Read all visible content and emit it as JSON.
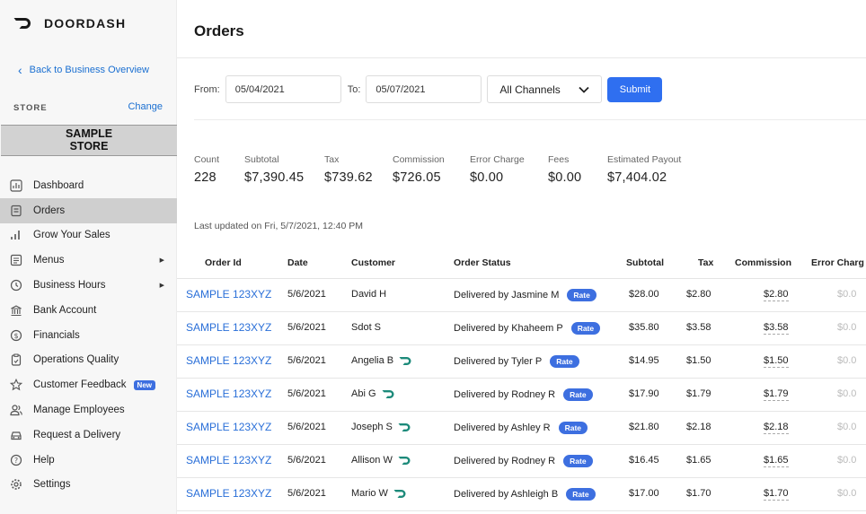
{
  "brand": {
    "name": "DOORDASH"
  },
  "sidebar": {
    "back_label": "Back to Business Overview",
    "store_label": "STORE",
    "change_label": "Change",
    "store_name_line1": "SAMPLE",
    "store_name_line2": "STORE",
    "items": [
      {
        "label": "Dashboard",
        "icon": "chart-icon"
      },
      {
        "label": "Orders",
        "icon": "orders-icon",
        "active": true
      },
      {
        "label": "Grow Your Sales",
        "icon": "bars-icon"
      },
      {
        "label": "Menus",
        "icon": "menu-icon",
        "has_submenu": true
      },
      {
        "label": "Business Hours",
        "icon": "clock-icon",
        "has_submenu": true
      },
      {
        "label": "Bank Account",
        "icon": "bank-icon"
      },
      {
        "label": "Financials",
        "icon": "dollar-icon"
      },
      {
        "label": "Operations Quality",
        "icon": "clipboard-icon"
      },
      {
        "label": "Customer Feedback",
        "icon": "star-icon",
        "badge": "New"
      },
      {
        "label": "Manage Employees",
        "icon": "people-icon"
      },
      {
        "label": "Request a Delivery",
        "icon": "car-icon"
      },
      {
        "label": "Help",
        "icon": "help-icon"
      },
      {
        "label": "Settings",
        "icon": "gear-icon"
      }
    ]
  },
  "main": {
    "title": "Orders",
    "filters": {
      "from_label": "From:",
      "from_value": "05/04/2021",
      "to_label": "To:",
      "to_value": "05/07/2021",
      "channel": "All Channels",
      "submit_label": "Submit"
    },
    "stats": [
      {
        "label": "Count",
        "value": "228"
      },
      {
        "label": "Subtotal",
        "value": "$7,390.45"
      },
      {
        "label": "Tax",
        "value": "$739.62"
      },
      {
        "label": "Commission",
        "value": "$726.05"
      },
      {
        "label": "Error Charge",
        "value": "$0.00"
      },
      {
        "label": "Fees",
        "value": "$0.00"
      },
      {
        "label": "Estimated Payout",
        "value": "$7,404.02"
      }
    ],
    "last_updated": "Last updated on Fri, 5/7/2021, 12:40 PM",
    "table": {
      "headers": {
        "order_id": "Order Id",
        "date": "Date",
        "customer": "Customer",
        "status": "Order Status",
        "subtotal": "Subtotal",
        "tax": "Tax",
        "commission": "Commission",
        "error_charge": "Error Charg"
      },
      "rate_label": "Rate",
      "rows": [
        {
          "order_id": "SAMPLE 123XYZ",
          "date": "5/6/2021",
          "customer": "David H",
          "dasher_icon": false,
          "status": "Delivered by Jasmine M",
          "subtotal": "$28.00",
          "tax": "$2.80",
          "commission": "$2.80",
          "error_charge": "$0.0"
        },
        {
          "order_id": "SAMPLE 123XYZ",
          "date": "5/6/2021",
          "customer": "Sdot S",
          "dasher_icon": false,
          "status": "Delivered by Khaheem P",
          "subtotal": "$35.80",
          "tax": "$3.58",
          "commission": "$3.58",
          "error_charge": "$0.0"
        },
        {
          "order_id": "SAMPLE 123XYZ",
          "date": "5/6/2021",
          "customer": "Angelia B",
          "dasher_icon": true,
          "status": "Delivered by Tyler P",
          "subtotal": "$14.95",
          "tax": "$1.50",
          "commission": "$1.50",
          "error_charge": "$0.0"
        },
        {
          "order_id": "SAMPLE 123XYZ",
          "date": "5/6/2021",
          "customer": "Abi G",
          "dasher_icon": true,
          "status": "Delivered by Rodney R",
          "subtotal": "$17.90",
          "tax": "$1.79",
          "commission": "$1.79",
          "error_charge": "$0.0"
        },
        {
          "order_id": "SAMPLE 123XYZ",
          "date": "5/6/2021",
          "customer": "Joseph S",
          "dasher_icon": true,
          "status": "Delivered by Ashley R",
          "subtotal": "$21.80",
          "tax": "$2.18",
          "commission": "$2.18",
          "error_charge": "$0.0"
        },
        {
          "order_id": "SAMPLE 123XYZ",
          "date": "5/6/2021",
          "customer": "Allison W",
          "dasher_icon": true,
          "status": "Delivered by Rodney R",
          "subtotal": "$16.45",
          "tax": "$1.65",
          "commission": "$1.65",
          "error_charge": "$0.0"
        },
        {
          "order_id": "SAMPLE 123XYZ",
          "date": "5/6/2021",
          "customer": "Mario W",
          "dasher_icon": true,
          "status": "Delivered by Ashleigh B",
          "subtotal": "$17.00",
          "tax": "$1.70",
          "commission": "$1.70",
          "error_charge": "$0.0"
        }
      ]
    }
  },
  "colors": {
    "accent": "#2f6ff0",
    "link": "#2a6fd8",
    "dasher_teal": "#1c8a7a"
  }
}
